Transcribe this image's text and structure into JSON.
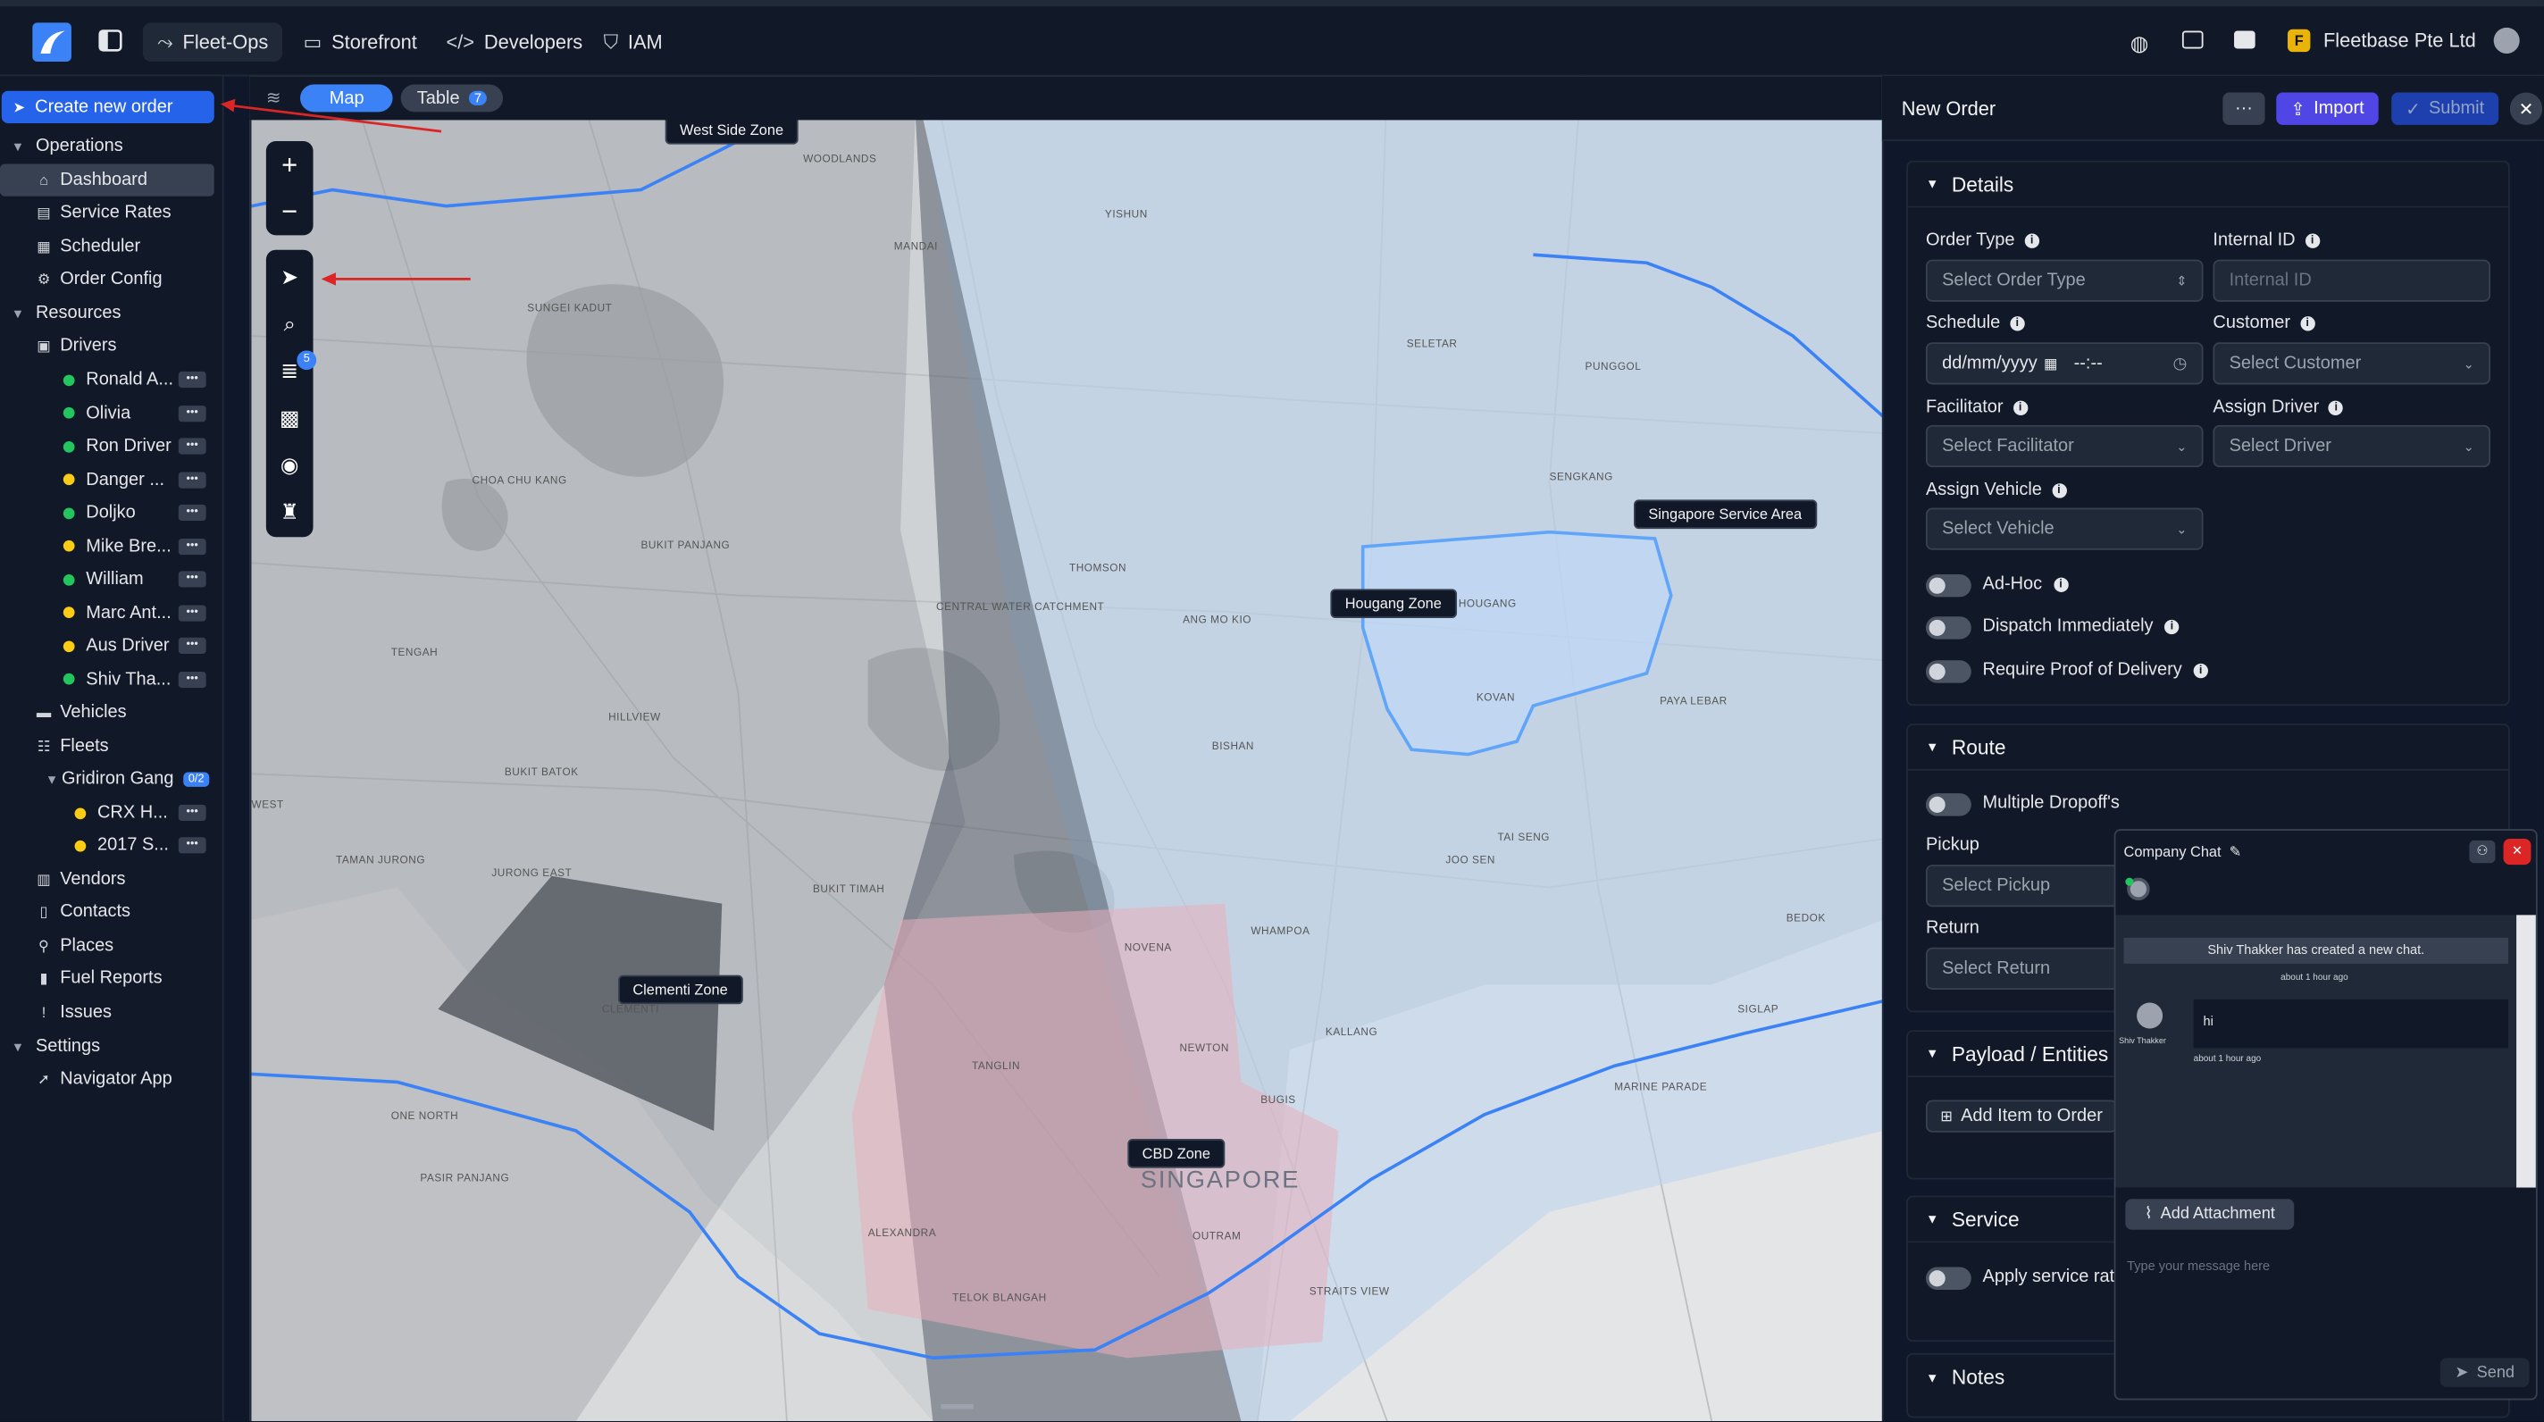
{
  "topbar": {
    "nav": [
      {
        "label": "Fleet-Ops",
        "icon": "route-icon"
      },
      {
        "label": "Storefront",
        "icon": "store-icon"
      },
      {
        "label": "Developers",
        "icon": "code-icon"
      },
      {
        "label": "IAM",
        "icon": "shield-icon"
      }
    ],
    "org_initial": "F",
    "org_name": "Fleetbase Pte Ltd"
  },
  "sidebar": {
    "create_label": "Create new order",
    "operations": {
      "label": "Operations",
      "items": [
        "Dashboard",
        "Service Rates",
        "Scheduler",
        "Order Config"
      ]
    },
    "resources": {
      "label": "Resources",
      "drivers_label": "Drivers",
      "drivers": [
        {
          "name": "Ronald A...",
          "status": "#22c55e"
        },
        {
          "name": "Olivia",
          "status": "#22c55e"
        },
        {
          "name": "Ron Driver",
          "status": "#22c55e"
        },
        {
          "name": "Danger ...",
          "status": "#facc15"
        },
        {
          "name": "Doljko",
          "status": "#22c55e"
        },
        {
          "name": "Mike Bre...",
          "status": "#facc15"
        },
        {
          "name": "William",
          "status": "#22c55e"
        },
        {
          "name": "Marc Ant...",
          "status": "#facc15"
        },
        {
          "name": "Aus Driver",
          "status": "#facc15"
        },
        {
          "name": "Shiv Tha...",
          "status": "#22c55e"
        }
      ],
      "vehicles_label": "Vehicles",
      "fleets_label": "Fleets",
      "fleet_group": {
        "name": "Gridiron Gang",
        "badge": "0/2"
      },
      "fleet_vehicles": [
        "CRX H...",
        "2017 S..."
      ],
      "others": [
        "Vendors",
        "Contacts",
        "Places",
        "Fuel Reports",
        "Issues"
      ]
    },
    "settings": {
      "label": "Settings",
      "items": [
        "Navigator App"
      ]
    }
  },
  "map": {
    "tabs": {
      "map": "Map",
      "table": "Table",
      "table_count": "7"
    },
    "layer_badge": "5",
    "zones": [
      "West Side Zone",
      "Singapore Service Area",
      "Hougang Zone",
      "Clementi Zone",
      "CBD Zone"
    ],
    "places": [
      "WOODLANDS",
      "YISHUN",
      "MANDAI",
      "SUNGEI KADUT",
      "SELETAR",
      "PUNGGOL",
      "CHOA CHU KANG",
      "BUKIT PANJANG",
      "SENGKANG",
      "THOMSON",
      "CENTRAL WATER CATCHMENT",
      "ANG MO KIO",
      "HOUGANG",
      "KOVAN",
      "TENGAH",
      "HILLVIEW",
      "BISHAN",
      "PAYA LEBAR",
      "BUKIT BATOK",
      "TAI SENG",
      "JOO SEN",
      "TAMAN JURONG",
      "JURONG EAST",
      "BUKIT TIMAH",
      "WHAMPOA",
      "BEDOK",
      "NOVENA",
      "CLEMENTI",
      "KALLANG",
      "SIGLAP",
      "TANGLIN",
      "NEWTON",
      "MARINE PARADE",
      "ONE NORTH",
      "BUGIS",
      "PASIR PANJANG",
      "SINGAPORE",
      "ALEXANDRA",
      "OUTRAM",
      "TELOK BLANGAH",
      "STRAITS VIEW",
      "WEST"
    ]
  },
  "panel": {
    "title": "New Order",
    "more": "···",
    "import": "Import",
    "submit": "Submit",
    "details": {
      "title": "Details",
      "order_type_label": "Order Type",
      "order_type_ph": "Select Order Type",
      "internal_id_label": "Internal ID",
      "internal_id_ph": "Internal ID",
      "schedule_label": "Schedule",
      "schedule_date": "dd/mm/yyyy",
      "schedule_time": "--:--",
      "customer_label": "Customer",
      "customer_ph": "Select Customer",
      "facilitator_label": "Facilitator",
      "facilitator_ph": "Select Facilitator",
      "driver_label": "Assign Driver",
      "driver_ph": "Select Driver",
      "vehicle_label": "Assign Vehicle",
      "vehicle_ph": "Select Vehicle",
      "adhoc": "Ad-Hoc",
      "dispatch": "Dispatch Immediately",
      "pod": "Require Proof of Delivery"
    },
    "route": {
      "title": "Route",
      "multi": "Multiple Dropoff's",
      "pickup_label": "Pickup",
      "pickup_ph": "Select Pickup",
      "return_label": "Return",
      "return_ph": "Select Return"
    },
    "payload": {
      "title": "Payload / Entities",
      "add": "Add Item to Order"
    },
    "service": {
      "title": "Service",
      "apply": "Apply service rat"
    },
    "notes": {
      "title": "Notes"
    }
  },
  "chat": {
    "title": "Company Chat",
    "system_msg": "Shiv Thakker has created a new chat.",
    "system_time": "about 1 hour ago",
    "sender": "Shiv Thakker",
    "message": "hi",
    "message_time": "about 1 hour ago",
    "attach": "Add Attachment",
    "input_ph": "Type your message here",
    "send": "Send"
  }
}
